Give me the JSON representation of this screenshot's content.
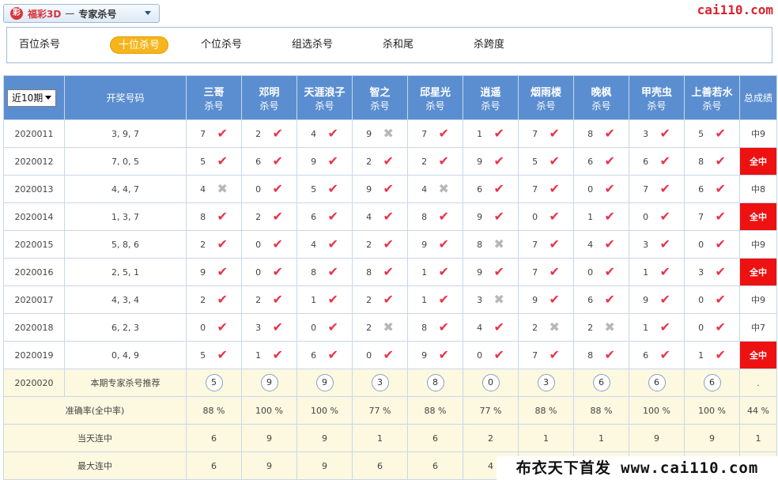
{
  "header": {
    "lottery_logo": "彩",
    "lottery_name": "福彩3D",
    "separator": "—",
    "mode": "专家杀号",
    "site_logo": "cai110.com"
  },
  "tabs": [
    {
      "label": "百位杀号",
      "active": false
    },
    {
      "label": "十位杀号",
      "active": true
    },
    {
      "label": "个位杀号",
      "active": false
    },
    {
      "label": "组选杀号",
      "active": false
    },
    {
      "label": "杀和尾",
      "active": false
    },
    {
      "label": "杀跨度",
      "active": false
    }
  ],
  "table": {
    "period_select": "近10期",
    "draw_header": "开奖号码",
    "total_header": "总成绩",
    "experts": [
      {
        "name": "三哥",
        "sub": "杀号"
      },
      {
        "name": "邓明",
        "sub": "杀号"
      },
      {
        "name": "天涯浪子",
        "sub": "杀号"
      },
      {
        "name": "智之",
        "sub": "杀号"
      },
      {
        "name": "邱星光",
        "sub": "杀号"
      },
      {
        "name": "逍遥",
        "sub": "杀号"
      },
      {
        "name": "烟雨楼",
        "sub": "杀号"
      },
      {
        "name": "晚枫",
        "sub": "杀号"
      },
      {
        "name": "甲壳虫",
        "sub": "杀号"
      },
      {
        "name": "上善若水",
        "sub": "杀号"
      }
    ],
    "rows": [
      {
        "issue": "2020011",
        "draw": "3, 9, 7",
        "picks": [
          "7",
          "2",
          "4",
          "9",
          "7",
          "1",
          "7",
          "8",
          "3",
          "5"
        ],
        "hits": [
          true,
          true,
          true,
          false,
          true,
          true,
          true,
          true,
          true,
          true
        ],
        "total": "中9",
        "full": false
      },
      {
        "issue": "2020012",
        "draw": "7, 0, 5",
        "picks": [
          "5",
          "6",
          "9",
          "2",
          "2",
          "9",
          "5",
          "6",
          "6",
          "8"
        ],
        "hits": [
          true,
          true,
          true,
          true,
          true,
          true,
          true,
          true,
          true,
          true
        ],
        "total": "全中",
        "full": true
      },
      {
        "issue": "2020013",
        "draw": "4, 4, 7",
        "picks": [
          "4",
          "0",
          "5",
          "9",
          "4",
          "6",
          "7",
          "0",
          "7",
          "6"
        ],
        "hits": [
          false,
          true,
          true,
          true,
          false,
          true,
          true,
          true,
          true,
          true
        ],
        "total": "中8",
        "full": false
      },
      {
        "issue": "2020014",
        "draw": "1, 3, 7",
        "picks": [
          "8",
          "2",
          "6",
          "4",
          "8",
          "9",
          "0",
          "1",
          "0",
          "7"
        ],
        "hits": [
          true,
          true,
          true,
          true,
          true,
          true,
          true,
          true,
          true,
          true
        ],
        "total": "全中",
        "full": true
      },
      {
        "issue": "2020015",
        "draw": "5, 8, 6",
        "picks": [
          "2",
          "0",
          "4",
          "2",
          "9",
          "8",
          "7",
          "4",
          "3",
          "0"
        ],
        "hits": [
          true,
          true,
          true,
          true,
          true,
          false,
          true,
          true,
          true,
          true
        ],
        "total": "中9",
        "full": false
      },
      {
        "issue": "2020016",
        "draw": "2, 5, 1",
        "picks": [
          "9",
          "0",
          "8",
          "8",
          "1",
          "9",
          "7",
          "0",
          "1",
          "3"
        ],
        "hits": [
          true,
          true,
          true,
          true,
          true,
          true,
          true,
          true,
          true,
          true
        ],
        "total": "全中",
        "full": true
      },
      {
        "issue": "2020017",
        "draw": "4, 3, 4",
        "picks": [
          "2",
          "2",
          "1",
          "2",
          "1",
          "3",
          "9",
          "6",
          "9",
          "0"
        ],
        "hits": [
          true,
          true,
          true,
          true,
          true,
          false,
          true,
          true,
          true,
          true
        ],
        "total": "中9",
        "full": false
      },
      {
        "issue": "2020018",
        "draw": "6, 2, 3",
        "picks": [
          "0",
          "3",
          "0",
          "2",
          "8",
          "4",
          "2",
          "2",
          "1",
          "0"
        ],
        "hits": [
          true,
          true,
          true,
          false,
          true,
          true,
          false,
          false,
          true,
          true
        ],
        "total": "中7",
        "full": false
      },
      {
        "issue": "2020019",
        "draw": "0, 4, 9",
        "picks": [
          "5",
          "1",
          "6",
          "0",
          "9",
          "0",
          "7",
          "8",
          "6",
          "1"
        ],
        "hits": [
          true,
          true,
          true,
          true,
          true,
          true,
          true,
          true,
          true,
          true
        ],
        "total": "全中",
        "full": true
      }
    ],
    "recommend": {
      "issue": "2020020",
      "label": "本期专家杀号推荐",
      "picks": [
        "5",
        "9",
        "9",
        "3",
        "8",
        "0",
        "3",
        "6",
        "6",
        "6"
      ],
      "total": "."
    },
    "stats": [
      {
        "label": "准确率(全中率)",
        "values": [
          "88 %",
          "100 %",
          "100 %",
          "77 %",
          "88 %",
          "77 %",
          "88 %",
          "88 %",
          "100 %",
          "100 %"
        ],
        "total": "44 %"
      },
      {
        "label": "当天连中",
        "values": [
          "6",
          "9",
          "9",
          "1",
          "6",
          "2",
          "1",
          "1",
          "9",
          "9"
        ],
        "total": "1"
      },
      {
        "label": "最大连中",
        "values": [
          "6",
          "9",
          "9",
          "6",
          "6",
          "4",
          "",
          "",
          "",
          ""
        ],
        "total": ""
      }
    ]
  },
  "icons": {
    "hit": "check-mark-icon",
    "miss": "cross-mark-icon"
  },
  "colors": {
    "header_bg": "#5b8ed0",
    "hit": "#e8334a",
    "full_bg": "#ee1111",
    "active_tab": "#f7b51c"
  },
  "watermark": "布衣天下首发 www.cai110.com"
}
